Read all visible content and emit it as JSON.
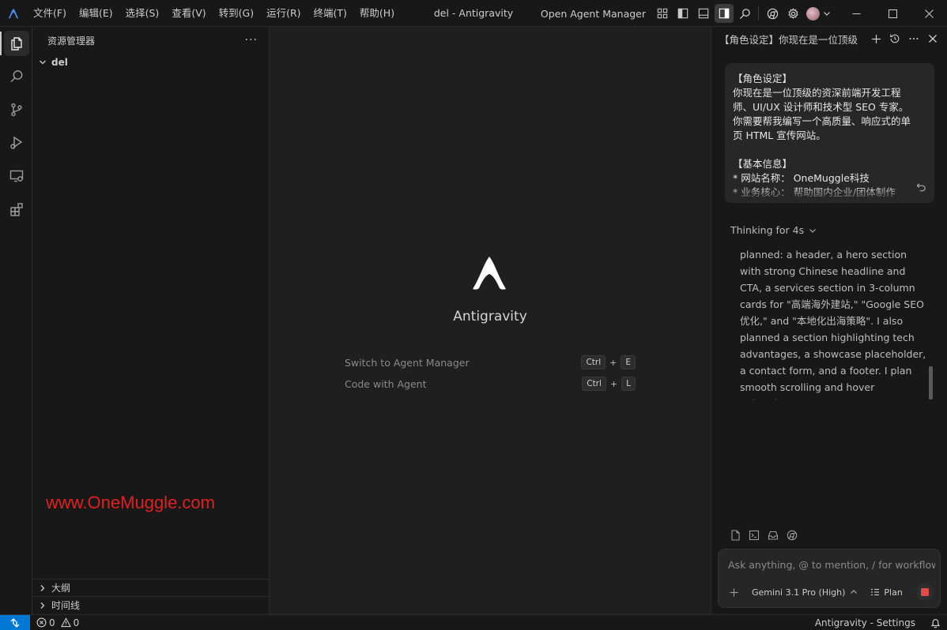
{
  "app": {
    "window_title": "del - Antigravity",
    "menu": [
      "文件(F)",
      "编辑(E)",
      "选择(S)",
      "查看(V)",
      "转到(G)",
      "运行(R)",
      "终端(T)",
      "帮助(H)"
    ],
    "open_agent_manager": "Open Agent Manager",
    "accent_color": "#0078d4"
  },
  "activity_bar": {
    "items": [
      "explorer-icon",
      "search-icon",
      "source-control-icon",
      "run-debug-icon",
      "remote-explorer-icon",
      "extensions-icon"
    ]
  },
  "sidebar": {
    "title": "资源管理器",
    "more": "···",
    "folder": "del",
    "watermark": "www.OneMuggle.com",
    "outline": "大纲",
    "timeline": "时间线"
  },
  "welcome": {
    "name": "Antigravity",
    "actions": [
      {
        "label": "Switch to Agent Manager",
        "keys": [
          "Ctrl",
          "+",
          "E"
        ]
      },
      {
        "label": "Code with Agent",
        "keys": [
          "Ctrl",
          "+",
          "L"
        ]
      }
    ]
  },
  "agent": {
    "title": "【角色设定】你现在是一位顶级",
    "user_message": "【角色设定】\n你现在是一位顶级的资深前端开发工程师、UI/UX 设计师和技术型 SEO 专家。你需要帮我编写一个高质量、响应式的单页 HTML 宣传网站。\n\n【基本信息】\n* 网站名称： OneMuggle科技\n* 业务核心： 帮助国内企业/团体制作",
    "thinking_label": "Thinking for 4s",
    "thinking_text": "planned: a header, a hero section with strong Chinese headline and CTA, a services section in 3-column cards for \"高端海外建站,\" \"Google SEO 优化,\" and \"本地化出海策略\". I also planned a section highlighting tech advantages, a showcase placeholder, a contact form, and a footer. I plan smooth scrolling and hover animations.",
    "input_placeholder": "Ask anything, @ to mention, / for workflows",
    "model": "Gemini 3.1 Pro (High)",
    "plan": "Plan",
    "stop_color": "#e04a4a"
  },
  "status": {
    "errors": "0",
    "warnings": "0",
    "settings": "Antigravity - Settings"
  }
}
